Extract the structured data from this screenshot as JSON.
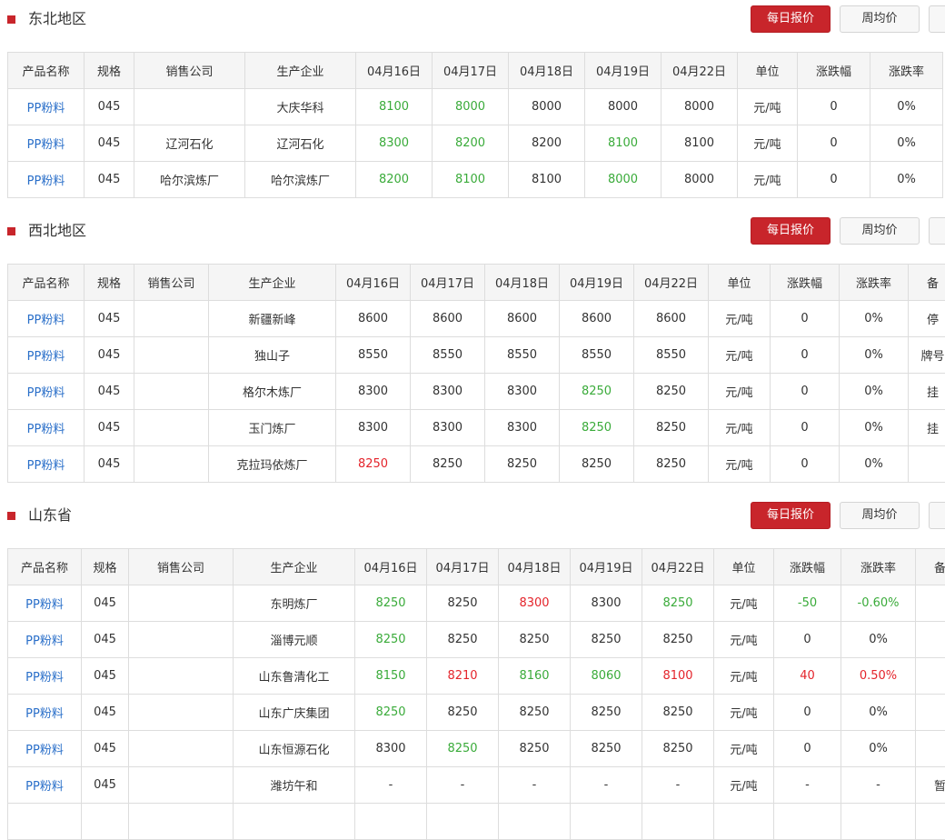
{
  "buttons": {
    "daily": "每日报价",
    "weekly": "周均价"
  },
  "sections": [
    {
      "title": "东北地区",
      "headers": [
        "产品名称",
        "规格",
        "销售公司",
        "生产企业",
        "04月16日",
        "04月17日",
        "04月18日",
        "04月19日",
        "04月22日",
        "单位",
        "涨跌幅",
        "涨跌率"
      ],
      "widths": [
        84,
        55,
        122,
        122,
        84,
        84,
        84,
        84,
        84,
        66,
        80,
        80
      ],
      "rows": [
        {
          "cells": [
            "PP粉料",
            "045",
            "",
            "大庆华科",
            "8100",
            "8000",
            "8000",
            "8000",
            "8000",
            "元/吨",
            "0",
            "0%"
          ],
          "trend": [
            "",
            "",
            "",
            "",
            "down",
            "down",
            "",
            "",
            "",
            "",
            "",
            ""
          ]
        },
        {
          "cells": [
            "PP粉料",
            "045",
            "辽河石化",
            "辽河石化",
            "8300",
            "8200",
            "8200",
            "8100",
            "8100",
            "元/吨",
            "0",
            "0%"
          ],
          "trend": [
            "",
            "",
            "",
            "",
            "down",
            "down",
            "",
            "down",
            "",
            "",
            "",
            ""
          ]
        },
        {
          "cells": [
            "PP粉料",
            "045",
            "哈尔滨炼厂",
            "哈尔滨炼厂",
            "8200",
            "8100",
            "8100",
            "8000",
            "8000",
            "元/吨",
            "0",
            "0%"
          ],
          "trend": [
            "",
            "",
            "",
            "",
            "down",
            "down",
            "",
            "down",
            "",
            "",
            "",
            ""
          ]
        }
      ]
    },
    {
      "title": "西北地区",
      "headers": [
        "产品名称",
        "规格",
        "销售公司",
        "生产企业",
        "04月16日",
        "04月17日",
        "04月18日",
        "04月19日",
        "04月22日",
        "单位",
        "涨跌幅",
        "涨跌率",
        "备"
      ],
      "widths": [
        84,
        55,
        82,
        140,
        82,
        82,
        82,
        82,
        82,
        68,
        76,
        76,
        54
      ],
      "rows": [
        {
          "cells": [
            "PP粉料",
            "045",
            "",
            "新疆新峰",
            "8600",
            "8600",
            "8600",
            "8600",
            "8600",
            "元/吨",
            "0",
            "0%",
            "停"
          ],
          "trend": [
            "",
            "",
            "",
            "",
            "",
            "",
            "",
            "",
            "",
            "",
            "",
            "",
            ""
          ]
        },
        {
          "cells": [
            "PP粉料",
            "045",
            "",
            "独山子",
            "8550",
            "8550",
            "8550",
            "8550",
            "8550",
            "元/吨",
            "0",
            "0%",
            "牌号"
          ],
          "trend": [
            "",
            "",
            "",
            "",
            "",
            "",
            "",
            "",
            "",
            "",
            "",
            "",
            ""
          ]
        },
        {
          "cells": [
            "PP粉料",
            "045",
            "",
            "格尔木炼厂",
            "8300",
            "8300",
            "8300",
            "8250",
            "8250",
            "元/吨",
            "0",
            "0%",
            "挂"
          ],
          "trend": [
            "",
            "",
            "",
            "",
            "",
            "",
            "",
            "down",
            "",
            "",
            "",
            "",
            ""
          ]
        },
        {
          "cells": [
            "PP粉料",
            "045",
            "",
            "玉门炼厂",
            "8300",
            "8300",
            "8300",
            "8250",
            "8250",
            "元/吨",
            "0",
            "0%",
            "挂"
          ],
          "trend": [
            "",
            "",
            "",
            "",
            "",
            "",
            "",
            "down",
            "",
            "",
            "",
            "",
            ""
          ]
        },
        {
          "cells": [
            "PP粉料",
            "045",
            "",
            "克拉玛依炼厂",
            "8250",
            "8250",
            "8250",
            "8250",
            "8250",
            "元/吨",
            "0",
            "0%",
            ""
          ],
          "trend": [
            "",
            "",
            "",
            "",
            "up",
            "",
            "",
            "",
            "",
            "",
            "",
            "",
            ""
          ]
        }
      ]
    },
    {
      "title": "山东省",
      "headers": [
        "产品名称",
        "规格",
        "销售公司",
        "生产企业",
        "04月16日",
        "04月17日",
        "04月18日",
        "04月19日",
        "04月22日",
        "单位",
        "涨跌幅",
        "涨跌率",
        "备"
      ],
      "widths": [
        81,
        52,
        115,
        134,
        79,
        79,
        79,
        79,
        79,
        66,
        74,
        82,
        54
      ],
      "rows": [
        {
          "cells": [
            "PP粉料",
            "045",
            "",
            "东明炼厂",
            "8250",
            "8250",
            "8300",
            "8300",
            "8250",
            "元/吨",
            "-50",
            "-0.60%",
            ""
          ],
          "trend": [
            "",
            "",
            "",
            "",
            "down",
            "",
            "up",
            "",
            "down",
            "",
            "down",
            "down",
            ""
          ]
        },
        {
          "cells": [
            "PP粉料",
            "045",
            "",
            "淄博元顺",
            "8250",
            "8250",
            "8250",
            "8250",
            "8250",
            "元/吨",
            "0",
            "0%",
            ""
          ],
          "trend": [
            "",
            "",
            "",
            "",
            "down",
            "",
            "",
            "",
            "",
            "",
            "",
            "",
            ""
          ]
        },
        {
          "cells": [
            "PP粉料",
            "045",
            "",
            "山东鲁清化工",
            "8150",
            "8210",
            "8160",
            "8060",
            "8100",
            "元/吨",
            "40",
            "0.50%",
            ""
          ],
          "trend": [
            "",
            "",
            "",
            "",
            "down",
            "up",
            "down",
            "down",
            "up",
            "",
            "up",
            "up",
            ""
          ]
        },
        {
          "cells": [
            "PP粉料",
            "045",
            "",
            "山东广庆集团",
            "8250",
            "8250",
            "8250",
            "8250",
            "8250",
            "元/吨",
            "0",
            "0%",
            ""
          ],
          "trend": [
            "",
            "",
            "",
            "",
            "down",
            "",
            "",
            "",
            "",
            "",
            "",
            "",
            ""
          ]
        },
        {
          "cells": [
            "PP粉料",
            "045",
            "",
            "山东恒源石化",
            "8300",
            "8250",
            "8250",
            "8250",
            "8250",
            "元/吨",
            "0",
            "0%",
            ""
          ],
          "trend": [
            "",
            "",
            "",
            "",
            "",
            "down",
            "",
            "",
            "",
            "",
            "",
            "",
            ""
          ]
        },
        {
          "cells": [
            "PP粉料",
            "045",
            "",
            "潍坊午和",
            "-",
            "-",
            "-",
            "-",
            "-",
            "元/吨",
            "-",
            "-",
            "暂"
          ],
          "trend": [
            "",
            "",
            "",
            "",
            "",
            "",
            "",
            "",
            "",
            "",
            "",
            "",
            ""
          ]
        },
        {
          "cells": [
            "",
            "",
            "",
            "",
            "",
            "",
            "",
            "",
            "",
            "",
            "",
            "",
            ""
          ],
          "trend": [
            "",
            "",
            "",
            "",
            "",
            "",
            "",
            "",
            "",
            "",
            "",
            "",
            ""
          ]
        }
      ]
    }
  ]
}
